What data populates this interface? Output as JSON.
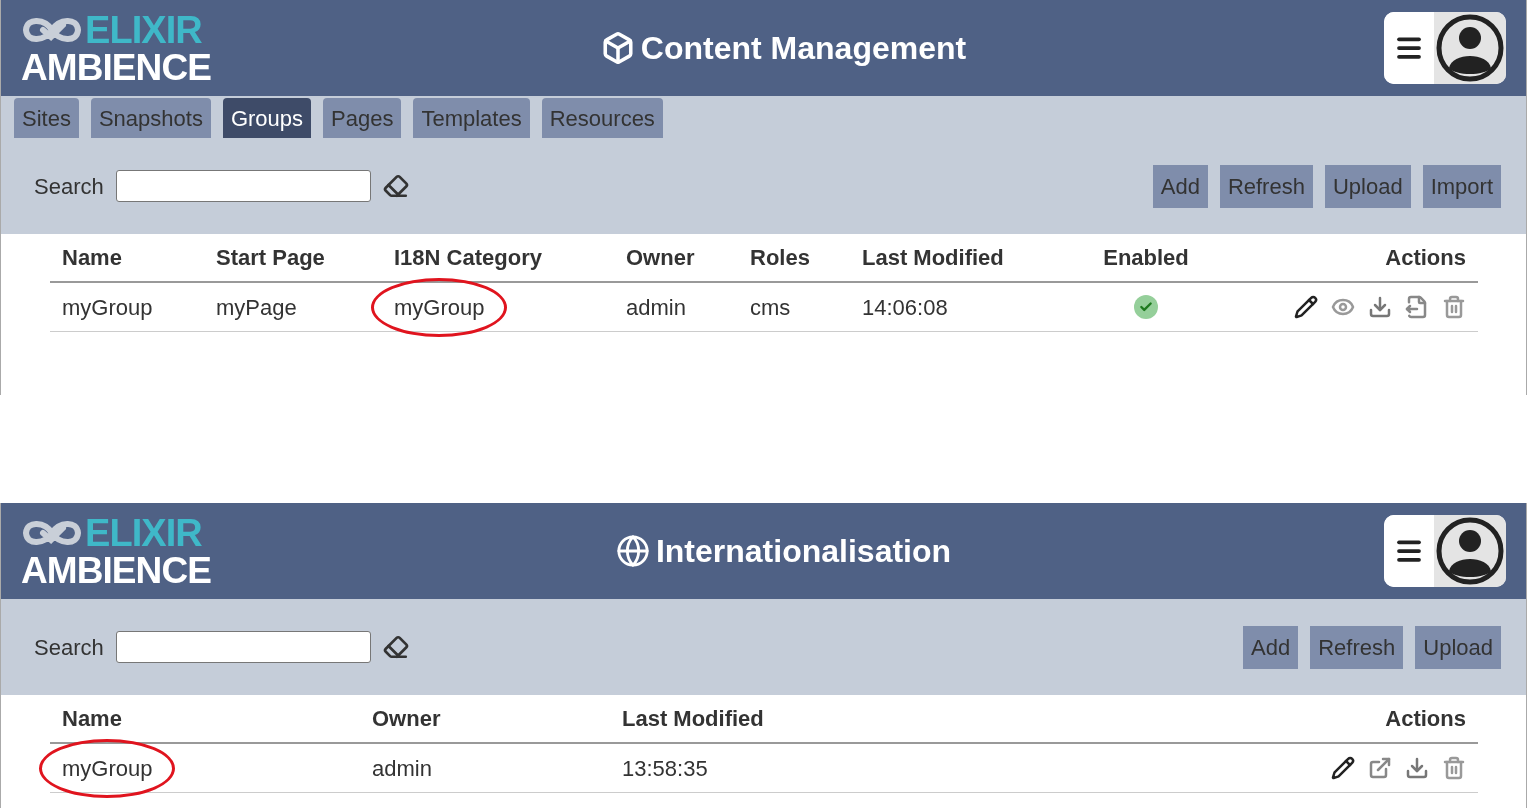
{
  "panels": [
    {
      "logo": {
        "top": "ELIXIR",
        "bottom": "AMBIENCE"
      },
      "title": {
        "kind": "cube",
        "text": "Content Management"
      },
      "tabs": [
        {
          "label": "Sites",
          "selected": false
        },
        {
          "label": "Snapshots",
          "selected": false
        },
        {
          "label": "Groups",
          "selected": true
        },
        {
          "label": "Pages",
          "selected": false
        },
        {
          "label": "Templates",
          "selected": false
        },
        {
          "label": "Resources",
          "selected": false
        }
      ],
      "search": {
        "label": "Search"
      },
      "buttons": [
        "Add",
        "Refresh",
        "Upload",
        "Import"
      ],
      "table": {
        "columns": [
          "Name",
          "Start Page",
          "I18N Category",
          "Owner",
          "Roles",
          "Last Modified",
          "Enabled",
          "Actions"
        ],
        "rows": [
          {
            "cells": [
              {
                "kind": "text",
                "text": "myGroup",
                "circled": false
              },
              {
                "kind": "text",
                "text": "myPage",
                "circled": false
              },
              {
                "kind": "text",
                "text": "myGroup",
                "circled": true
              },
              {
                "kind": "text",
                "text": "admin",
                "circled": false
              },
              {
                "kind": "text",
                "text": "cms",
                "circled": false
              },
              {
                "kind": "text",
                "text": "14:06:08",
                "circled": false
              },
              {
                "kind": "status",
                "enabled": true
              },
              {
                "kind": "actions",
                "actions": [
                  {
                    "kind": "edit"
                  },
                  {
                    "kind": "view"
                  },
                  {
                    "kind": "download"
                  },
                  {
                    "kind": "export"
                  },
                  {
                    "kind": "delete"
                  }
                ]
              }
            ]
          }
        ]
      }
    },
    {
      "logo": {
        "top": "ELIXIR",
        "bottom": "AMBIENCE"
      },
      "title": {
        "kind": "globe",
        "text": "Internationalisation"
      },
      "search": {
        "label": "Search"
      },
      "buttons": [
        "Add",
        "Refresh",
        "Upload"
      ],
      "table": {
        "columns": [
          "Name",
          "Owner",
          "Last Modified",
          "Actions"
        ],
        "rows": [
          {
            "cells": [
              {
                "kind": "text",
                "text": "myGroup",
                "circled": true
              },
              {
                "kind": "text",
                "text": "admin",
                "circled": false
              },
              {
                "kind": "text",
                "text": "13:58:35",
                "circled": false
              },
              {
                "kind": "actions",
                "actions": [
                  {
                    "kind": "edit"
                  },
                  {
                    "kind": "open"
                  },
                  {
                    "kind": "download"
                  },
                  {
                    "kind": "delete"
                  }
                ]
              }
            ]
          }
        ]
      }
    }
  ]
}
